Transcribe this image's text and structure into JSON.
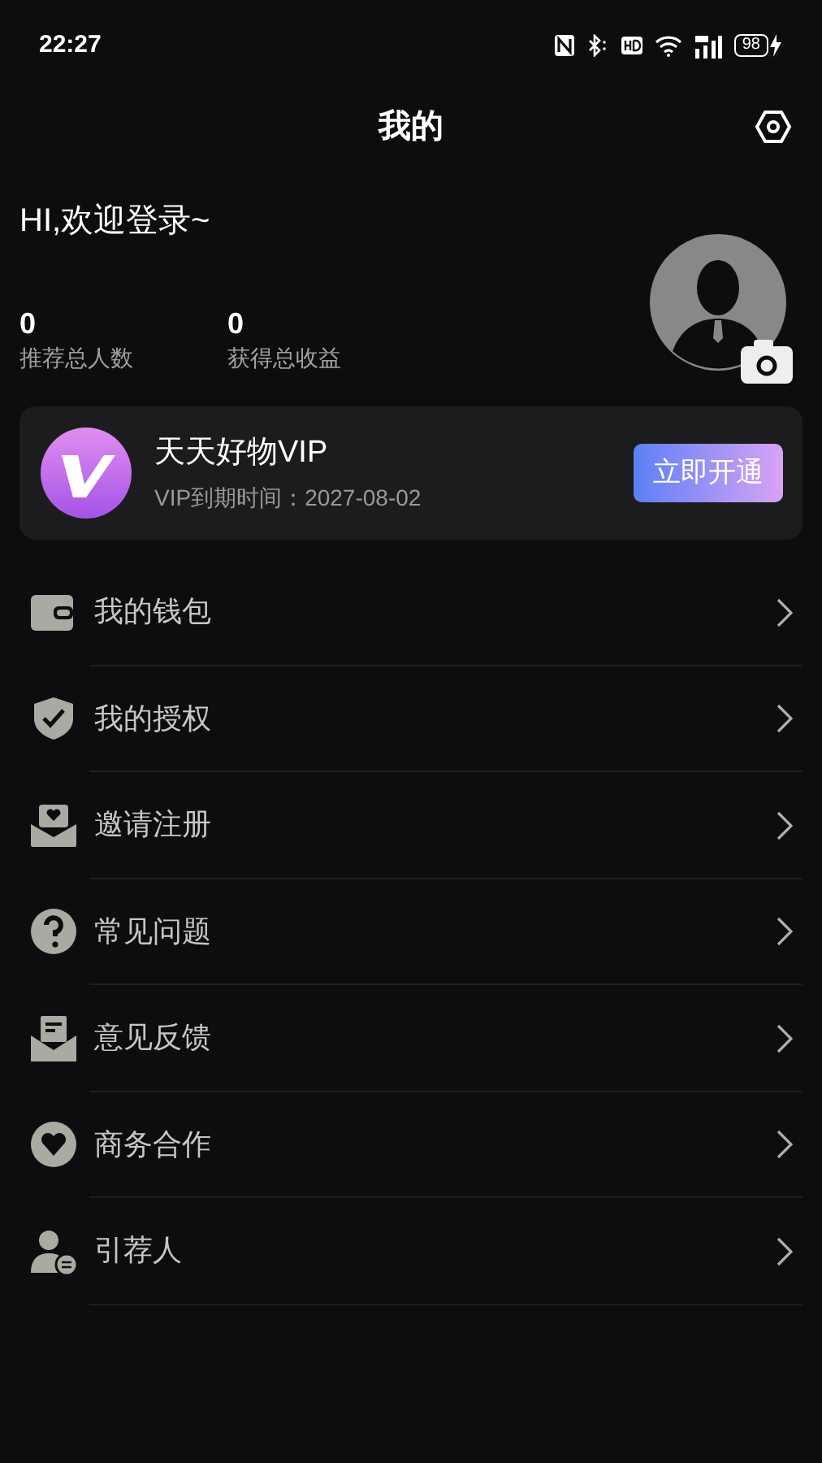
{
  "status_bar": {
    "time": "22:27",
    "battery": "98"
  },
  "header": {
    "title": "我的"
  },
  "profile": {
    "greeting": "HI,欢迎登录~",
    "stats": [
      {
        "value": "0",
        "label": "推荐总人数"
      },
      {
        "value": "0",
        "label": "获得总收益"
      }
    ]
  },
  "vip_card": {
    "title": "天天好物VIP",
    "expiry": "VIP到期时间：2027-08-02",
    "button": "立即开通"
  },
  "menu": [
    {
      "kind": "wallet",
      "label": "我的钱包"
    },
    {
      "kind": "shield",
      "label": "我的授权"
    },
    {
      "kind": "invite",
      "label": "邀请注册"
    },
    {
      "kind": "question",
      "label": "常见问题"
    },
    {
      "kind": "feedback",
      "label": "意见反馈"
    },
    {
      "kind": "handshake",
      "label": "商务合作"
    },
    {
      "kind": "referrer",
      "label": "引荐人"
    }
  ]
}
